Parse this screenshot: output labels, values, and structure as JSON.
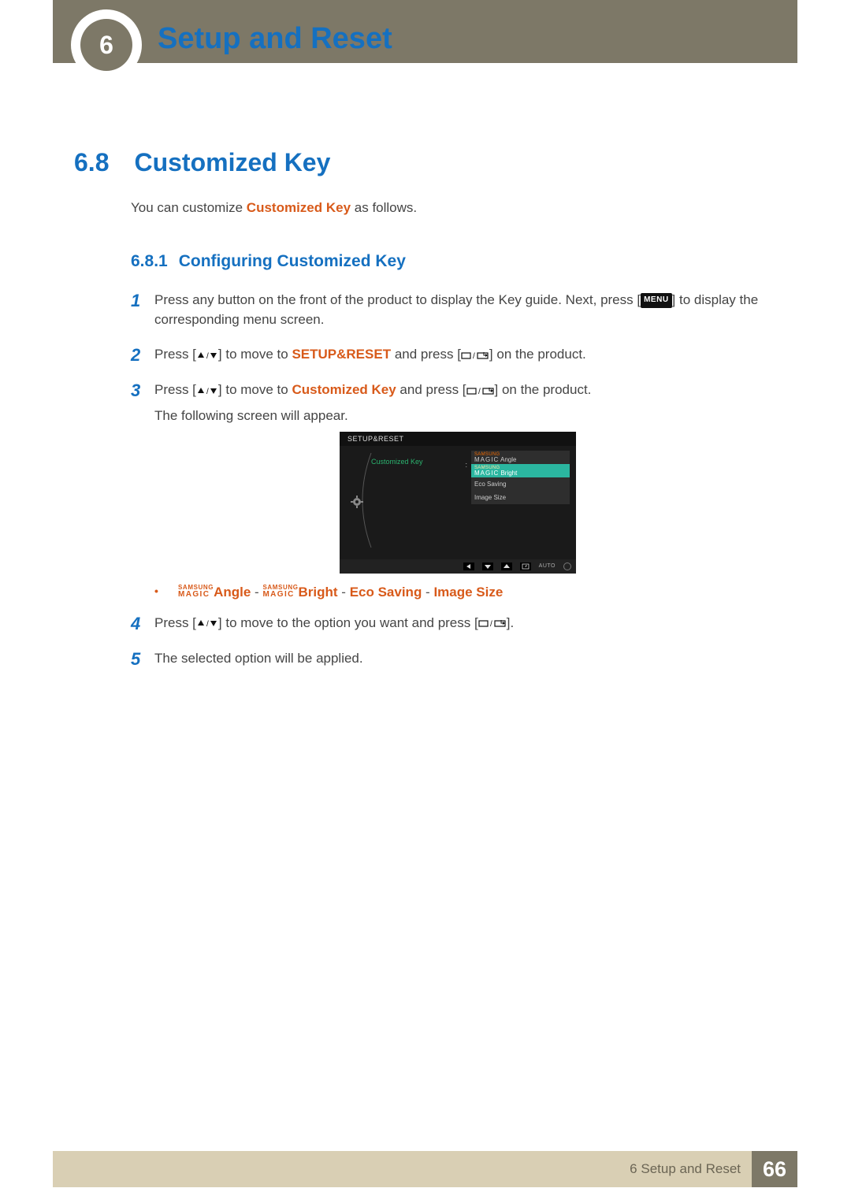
{
  "header": {
    "chapter_number": "6",
    "chapter_title": "Setup and Reset"
  },
  "section": {
    "number": "6.8",
    "title": "Customized Key"
  },
  "intro": {
    "pre": "You can customize ",
    "bold": "Customized Key",
    "post": " as follows."
  },
  "subsection": {
    "number": "6.8.1",
    "title": "Configuring Customized Key"
  },
  "steps": {
    "s1": {
      "num": "1",
      "t1": "Press any button on the front of the product to display the Key guide. Next, press [",
      "menu": "MENU",
      "t2": "] to display the corresponding menu screen."
    },
    "s2": {
      "num": "2",
      "t1": "Press [",
      "t2": "] to move to ",
      "bold": "SETUP&RESET",
      "t3": " and press [",
      "t4": "] on the product."
    },
    "s3": {
      "num": "3",
      "t1": "Press [",
      "t2": "] to move to ",
      "bold": "Customized Key",
      "t3": " and press [",
      "t4": "] on the product.",
      "t5": "The following screen will appear."
    },
    "s4": {
      "num": "4",
      "t1": "Press [",
      "t2": "] to move to the option you want and press [",
      "t3": "]."
    },
    "s5": {
      "num": "5",
      "t1": "The selected option will be applied."
    }
  },
  "osd": {
    "title": "SETUP&RESET",
    "label": "Customized Key",
    "opts": {
      "r1_brand_top": "SAMSUNG",
      "r1_brand_bot": "MAGIC",
      "r1_label": " Angle",
      "r2_brand_top": "SAMSUNG",
      "r2_brand_bot": "MAGIC",
      "r2_label": " Bright",
      "r3": "Eco Saving",
      "r4": "Image Size"
    },
    "auto": "AUTO"
  },
  "options_line": {
    "brand_top": "SAMSUNG",
    "brand_bot": "MAGIC",
    "angle": "Angle",
    "bright": "Bright",
    "eco": "Eco Saving",
    "size": "Image Size",
    "dash": " - "
  },
  "footer": {
    "chapter": "6 Setup and Reset",
    "page": "66"
  }
}
